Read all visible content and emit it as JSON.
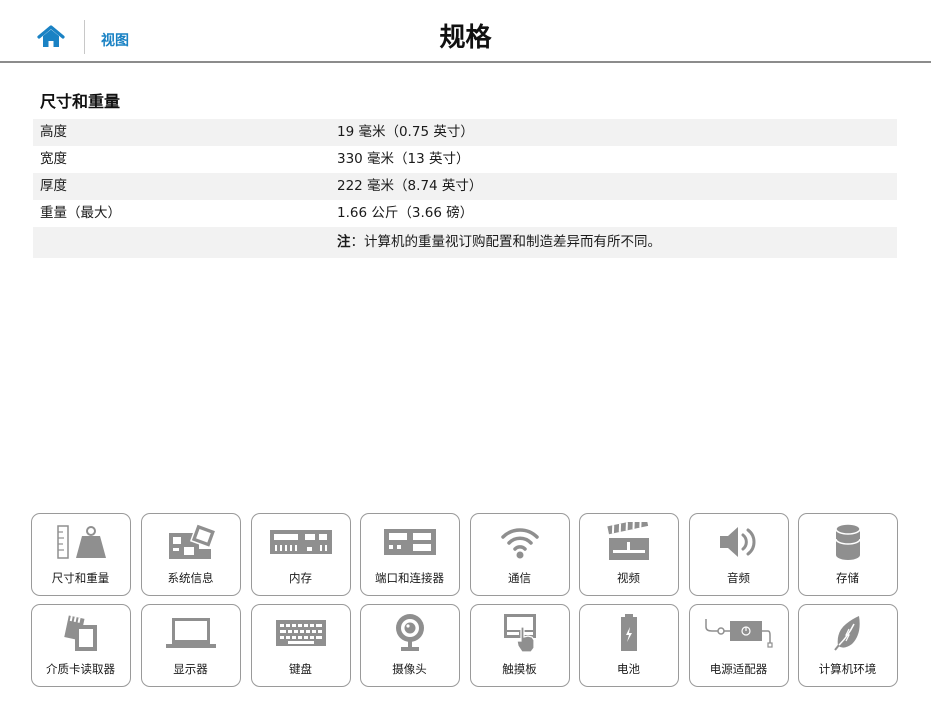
{
  "header": {
    "home_icon": "home-icon",
    "view_link": "视图",
    "title": "规格"
  },
  "section": {
    "title": "尺寸和重量"
  },
  "specs": [
    {
      "label": "高度",
      "value": "19 毫米（0.75 英寸）"
    },
    {
      "label": "宽度",
      "value": "330 毫米（13 英寸）"
    },
    {
      "label": "厚度",
      "value": "222 毫米（8.74 英寸）"
    },
    {
      "label": "重量（最大）",
      "value": "1.66 公斤（3.66 磅）"
    }
  ],
  "note": {
    "prefix": "注",
    "text": "：计算机的重量视订购配置和制造差异而有所不同。"
  },
  "tiles": [
    {
      "label": "尺寸和重量",
      "icon": "scale-weight-icon"
    },
    {
      "label": "系统信息",
      "icon": "chipset-icon"
    },
    {
      "label": "内存",
      "icon": "memory-module-icon"
    },
    {
      "label": "端口和连接器",
      "icon": "port-connector-icon"
    },
    {
      "label": "通信",
      "icon": "wifi-icon"
    },
    {
      "label": "视频",
      "icon": "clapperboard-icon"
    },
    {
      "label": "音频",
      "icon": "speaker-icon"
    },
    {
      "label": "存储",
      "icon": "storage-cylinder-icon"
    },
    {
      "label": "介质卡读取器",
      "icon": "media-card-icon"
    },
    {
      "label": "显示器",
      "icon": "laptop-display-icon"
    },
    {
      "label": "键盘",
      "icon": "keyboard-icon"
    },
    {
      "label": "摄像头",
      "icon": "webcam-icon"
    },
    {
      "label": "触摸板",
      "icon": "touchpad-icon"
    },
    {
      "label": "电池",
      "icon": "battery-icon"
    },
    {
      "label": "电源适配器",
      "icon": "power-adapter-icon"
    },
    {
      "label": "计算机环境",
      "icon": "leaf-icon"
    }
  ],
  "colors": {
    "accent": "#1a82c4",
    "icon_gray": "#8f8f8f",
    "row_shade": "#f2f2f2",
    "tile_border": "#9a9a9a"
  }
}
